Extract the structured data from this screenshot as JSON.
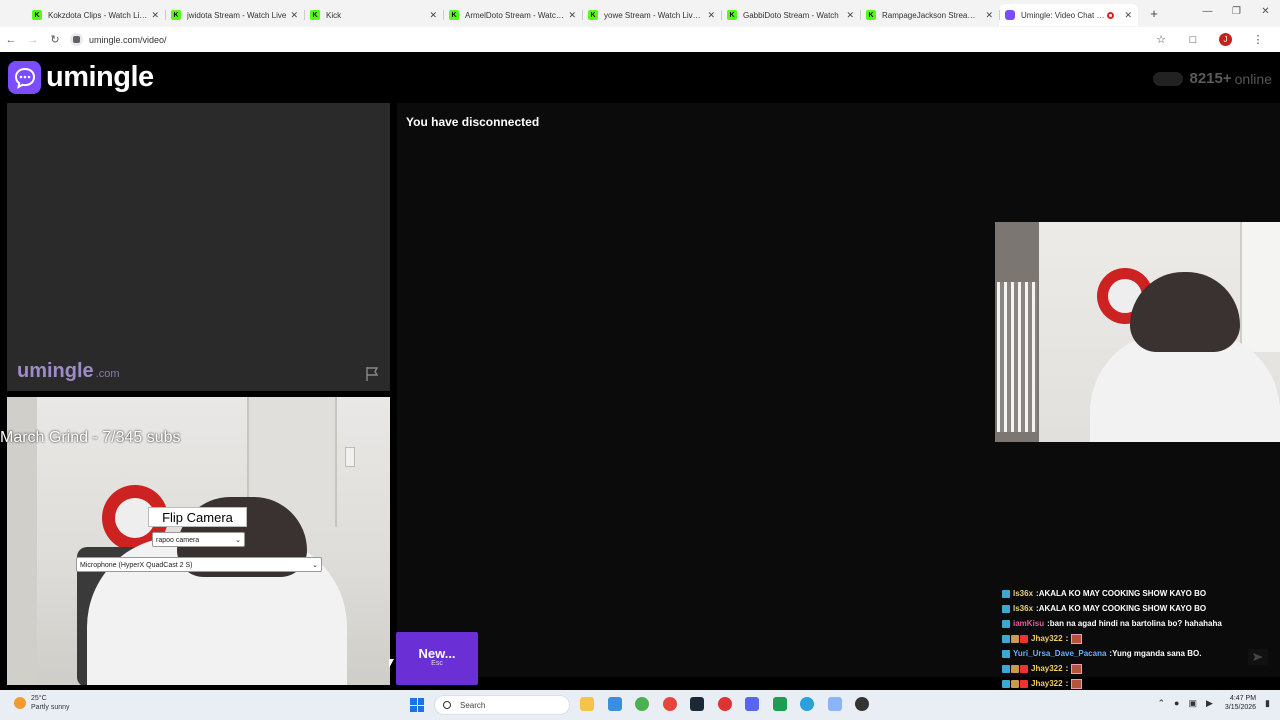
{
  "browser": {
    "tabs": [
      {
        "label": "Kokzdota Clips - Watch Live",
        "favicon": "kick-favicon",
        "active": false
      },
      {
        "label": "jwidota Stream - Watch Live",
        "favicon": "kick-favicon",
        "active": false
      },
      {
        "label": "Kick",
        "favicon": "kick-favicon",
        "active": false
      },
      {
        "label": "ArmelDoto Stream - Watch L",
        "favicon": "kick-favicon",
        "active": false
      },
      {
        "label": "yowe Stream - Watch Live o",
        "favicon": "kick-favicon",
        "active": false
      },
      {
        "label": "GabbiDoto Stream - Watch",
        "favicon": "kick-favicon",
        "active": false
      },
      {
        "label": "RampageJackson Stream - W",
        "favicon": "kick-favicon",
        "active": false
      },
      {
        "label": "Umingle: Video Chat with",
        "favicon": "umingle-favicon",
        "active": true
      }
    ],
    "url": "umingle.com/video/",
    "profile_initial": "J"
  },
  "site": {
    "brand": "umingle",
    "online_count": "8215+",
    "online_label": "online",
    "watermark_main": "umingle",
    "watermark_domain": ".com",
    "disconnect_message": "You have disconnected",
    "new_button_label": "New...",
    "new_button_hint": "Esc",
    "accent_color": "#6b2fd6"
  },
  "overlay": {
    "stream_title": "March Grind - 7/345 subs",
    "flip_camera": "Flip Camera",
    "camera_select": "rapoo camera",
    "mic_select": "Microphone (HyperX QuadCast 2 S)"
  },
  "chat": [
    {
      "user": "ls36x",
      "user_color": "#e8d27a",
      "message": "AKALA KO MAY COOKING SHOW KAYO BO",
      "emotes": 0
    },
    {
      "user": "ls36x",
      "user_color": "#e8d27a",
      "message": "AKALA KO MAY COOKING SHOW KAYO BO",
      "emotes": 0
    },
    {
      "user": "iamKisu",
      "user_color": "#e05a9b",
      "message": "ban na agad hindi na bartolina bo? hahahaha",
      "emotes": 0
    },
    {
      "user": "Jhay322",
      "user_color": "#f0d060",
      "message": "",
      "emotes": 1
    },
    {
      "user": "Yuri_Ursa_Dave_Pacana",
      "user_color": "#6ab0ff",
      "message": "Yung mganda sana BO.",
      "emotes": 0
    },
    {
      "user": "Jhay322",
      "user_color": "#f0d060",
      "message": "",
      "emotes": 1
    },
    {
      "user": "Jhay322",
      "user_color": "#f0d060",
      "message": "",
      "emotes": 1
    }
  ],
  "taskbar": {
    "weather_temp": "25°C",
    "weather_desc": "Partly sunny",
    "search_placeholder": "Search",
    "time": "4:47 PM",
    "date": "3/15/2026"
  }
}
